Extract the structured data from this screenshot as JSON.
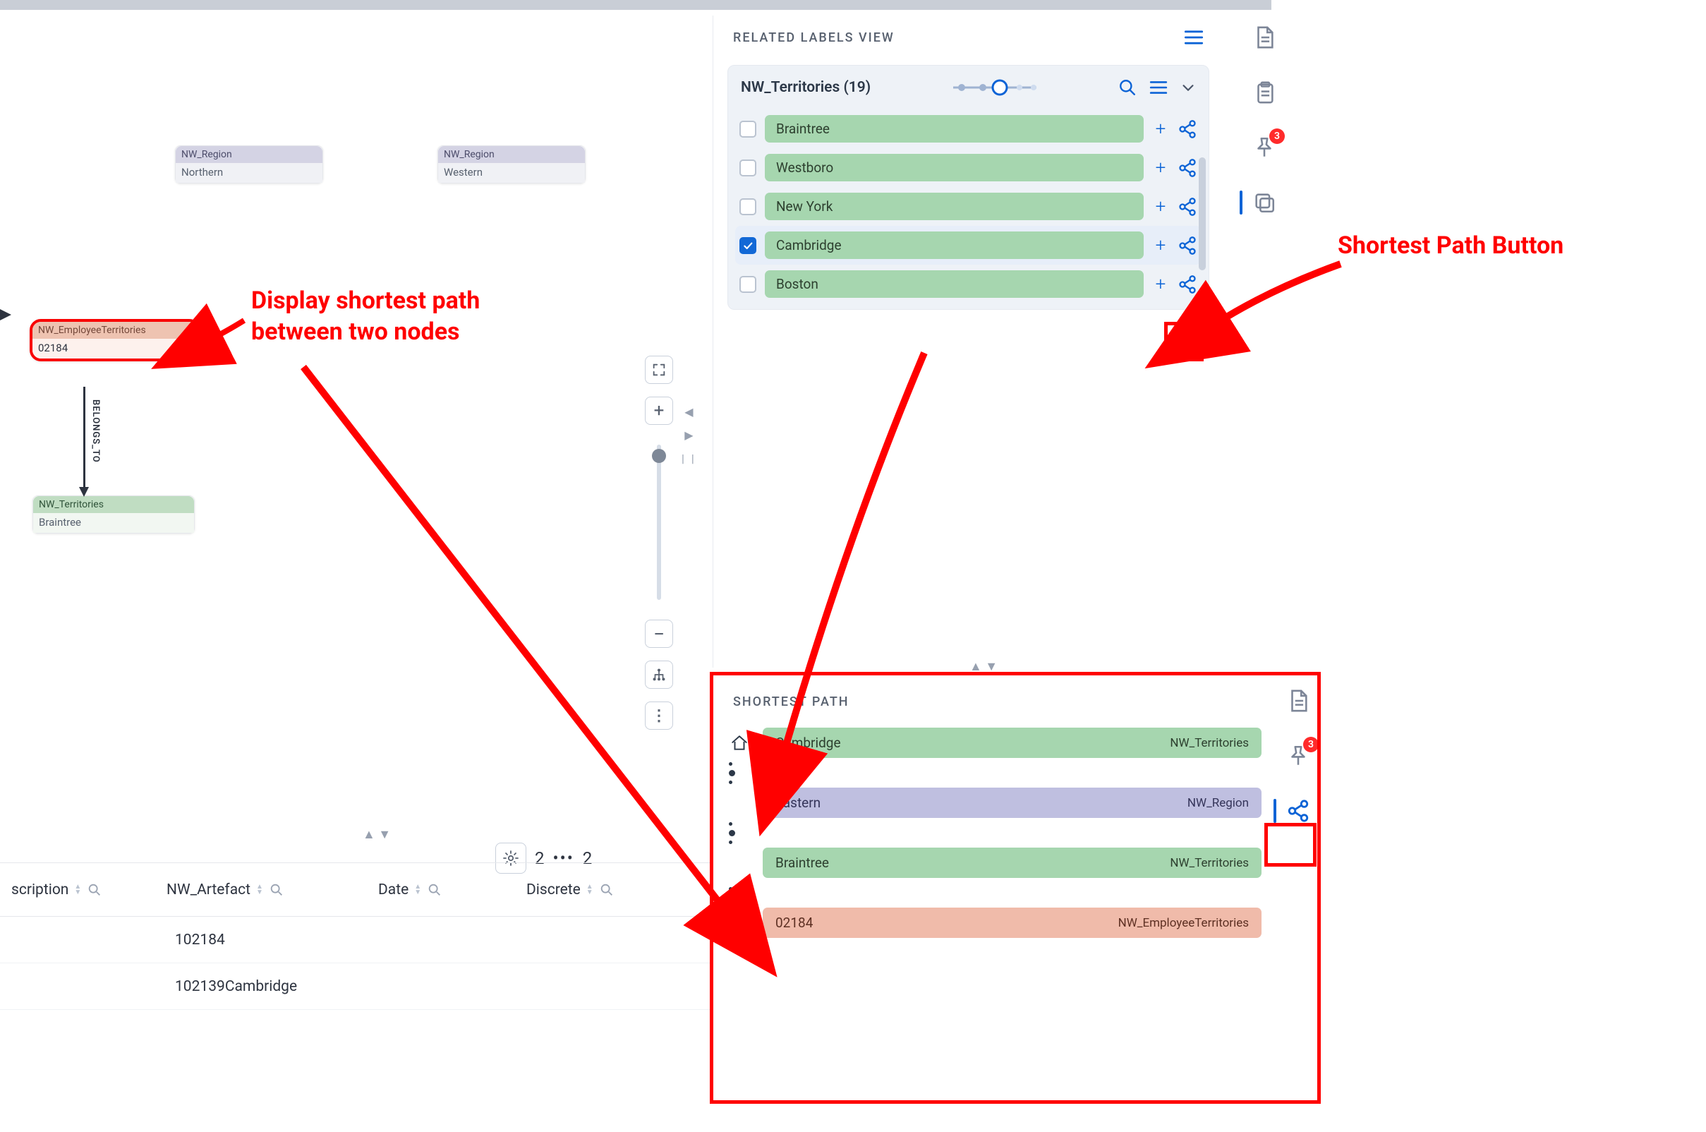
{
  "graph": {
    "region1": {
      "type": "NW_Region",
      "value": "Northern"
    },
    "region2": {
      "type": "NW_Region",
      "value": "Western"
    },
    "employeeTerr": {
      "type": "NW_EmployeeTerritories",
      "value": "02184"
    },
    "territory": {
      "type": "NW_Territories",
      "value": "Braintree"
    },
    "edge_label": "BELONGS_TO"
  },
  "relatedPanel": {
    "title": "RELATED LABELS VIEW",
    "card_title": "NW_Territories (19)",
    "items": [
      {
        "label": "Braintree",
        "checked": false
      },
      {
        "label": "Westboro",
        "checked": false
      },
      {
        "label": "New York",
        "checked": false
      },
      {
        "label": "Cambridge",
        "checked": true
      },
      {
        "label": "Boston",
        "checked": false
      }
    ]
  },
  "railBadge": "3",
  "shortestPath": {
    "title": "SHORTEST PATH",
    "rows": [
      {
        "name": "Cambridge",
        "type": "NW_Territories",
        "color": "green",
        "lead": "home"
      },
      {
        "name": "Eastern",
        "type": "NW_Region",
        "color": "purple",
        "lead": "dot"
      },
      {
        "name": "Braintree",
        "type": "NW_Territories",
        "color": "green",
        "lead": "dot"
      },
      {
        "name": "02184",
        "type": "NW_EmployeeTerritories",
        "color": "salmon",
        "lead": "pin"
      }
    ],
    "railBadge": "3"
  },
  "tools": {
    "fit": "⛶",
    "plus": "+",
    "minus": "−",
    "tree": "⋔",
    "more": "⋮"
  },
  "pager": {
    "page_left": "2",
    "page_right": "2"
  },
  "table": {
    "headers": [
      "scription",
      "NW_Artefact",
      "Date",
      "Discrete"
    ],
    "rows": [
      "102184",
      "102139Cambridge"
    ]
  },
  "annotations": {
    "left_label_l1": "Display shortest path",
    "left_label_l2": "between two nodes",
    "right_label": "Shortest Path Button"
  }
}
